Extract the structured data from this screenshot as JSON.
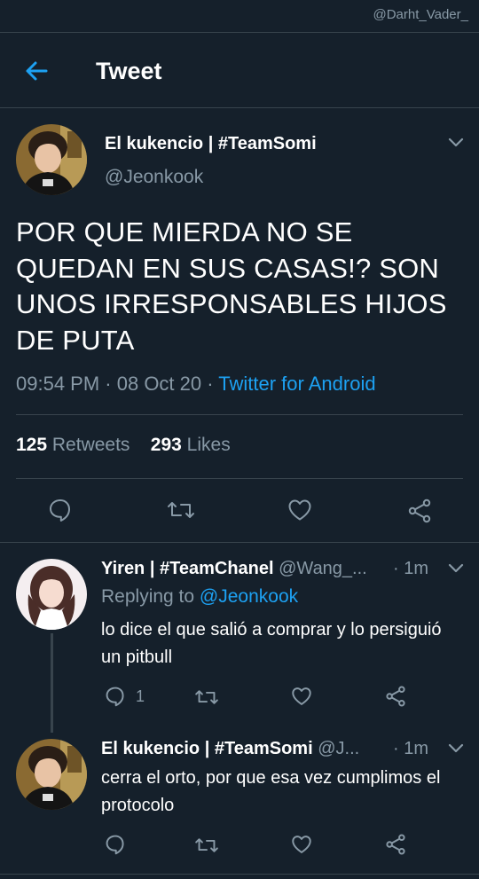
{
  "watermark": "@Darht_Vader_",
  "header": {
    "title": "Tweet"
  },
  "main_tweet": {
    "author_name": "El kukencio | #TeamSomi",
    "handle": "@Jeonkook",
    "text": "POR QUE MIERDA NO SE QUEDAN EN SUS CASAS!? SON UNOS IRRESPONSABLES HIJOS DE PUTA",
    "time": "09:54 PM",
    "sep": " · ",
    "date": "08 Oct 20",
    "source": "Twitter for Android",
    "retweets_count": "125",
    "retweets_label": "Retweets",
    "likes_count": "293",
    "likes_label": "Likes"
  },
  "replies": [
    {
      "author_name": "Yiren | #TeamChanel",
      "handle": "@Wang_...",
      "time": "· 1m",
      "replying_prefix": "Replying to",
      "replying_to": "@Jeonkook",
      "text": "lo dice el que salió a comprar y lo persiguió un pitbull",
      "reply_count": "1"
    },
    {
      "author_name": "El kukencio | #TeamSomi",
      "handle": "@J...",
      "time": "· 1m",
      "text": "cerra el orto, por que esa vez cumplimos el protocolo"
    }
  ],
  "icons": {
    "back": "arrow-left-icon",
    "more": "chevron-down-icon",
    "reply": "speech-bubble-icon",
    "retweet": "retweet-icon",
    "like": "heart-icon",
    "share": "share-icon"
  },
  "colors": {
    "background": "#15202b",
    "accent": "#1da1f2",
    "secondary_text": "#8899a6",
    "divider": "#38444d"
  }
}
